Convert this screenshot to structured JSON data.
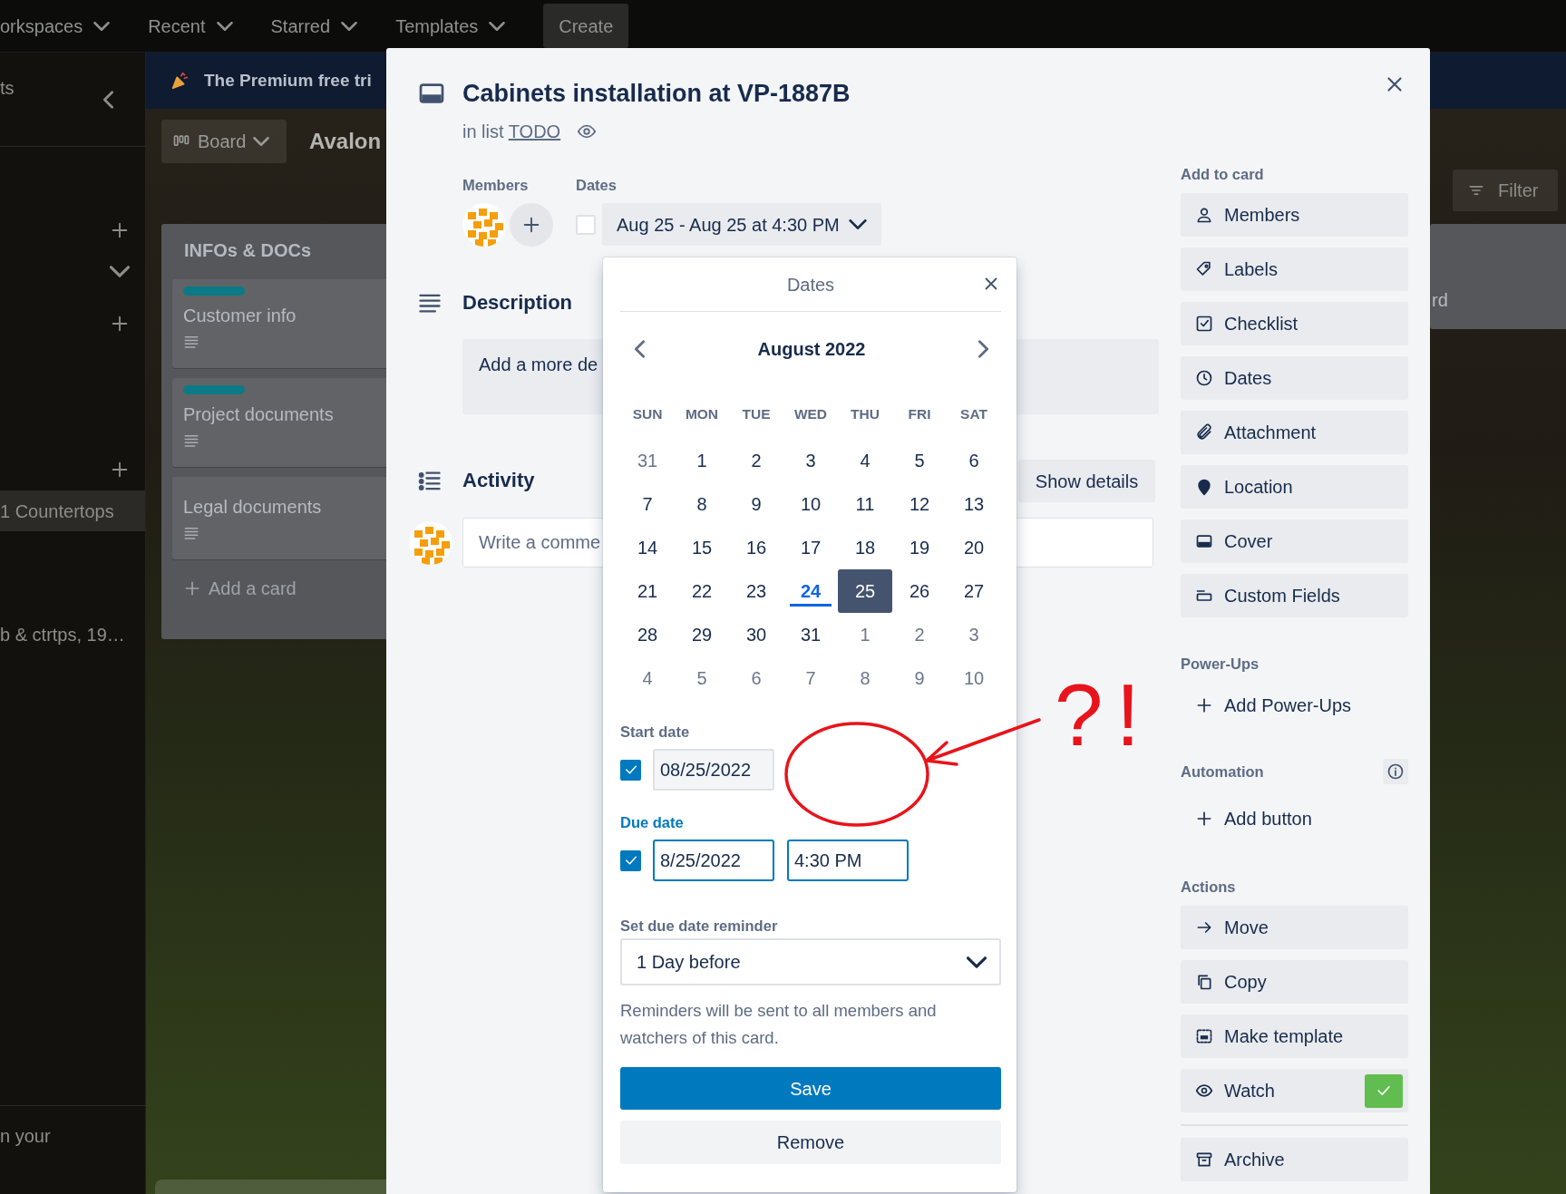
{
  "top_nav": {
    "items": [
      {
        "label": "orkspaces"
      },
      {
        "label": "Recent"
      },
      {
        "label": "Starred"
      },
      {
        "label": "Templates"
      }
    ],
    "create_button": "Create"
  },
  "sidebar": {
    "title": "ts",
    "items": [
      {
        "label": "1 Countertops",
        "selected": true
      },
      {
        "label": "b & ctrtps, 19…",
        "selected": false
      }
    ],
    "footer": "n your"
  },
  "banner": {
    "text": "The Premium free tri"
  },
  "board": {
    "view_button": "Board",
    "title": "Avalon",
    "filter_button": "Filter",
    "lists": [
      {
        "title": "INFOs & DOCs",
        "cards": [
          {
            "title": "Customer info",
            "labels": [
              {
                "color": "#0b7a86"
              }
            ],
            "has_description": true
          },
          {
            "title": "Project documents",
            "labels": [
              {
                "color": "#0b7a86"
              }
            ],
            "has_description": true
          },
          {
            "title": "Legal documents",
            "has_description": true
          }
        ],
        "add_card": "Add a card"
      }
    ],
    "partial_list": {
      "text": "rd"
    }
  },
  "card_modal": {
    "title": "Cabinets installation at VP-1887B",
    "list_prefix": "in list",
    "list_name": "TODO",
    "watching": true,
    "members_label": "Members",
    "dates_label": "Dates",
    "dates_complete": false,
    "dates_value": "Aug 25 - Aug 25 at 4:30 PM",
    "description_heading": "Description",
    "description_placeholder": "Add a more de",
    "activity_heading": "Activity",
    "show_details": "Show details",
    "comment_placeholder": "Write a comme",
    "sidebar": {
      "sections": [
        {
          "title": "Add to card",
          "info": false,
          "items": [
            {
              "label": "Members",
              "kind": "button"
            },
            {
              "label": "Labels",
              "kind": "button"
            },
            {
              "label": "Checklist",
              "kind": "button"
            },
            {
              "label": "Dates",
              "kind": "button"
            },
            {
              "label": "Attachment",
              "kind": "button"
            },
            {
              "label": "Location",
              "kind": "button"
            },
            {
              "label": "Cover",
              "kind": "button"
            },
            {
              "label": "Custom Fields",
              "kind": "button"
            }
          ]
        },
        {
          "title": "Power-Ups",
          "info": false,
          "items": [
            {
              "label": "Add Power-Ups",
              "kind": "link"
            }
          ]
        },
        {
          "title": "Automation",
          "info": true,
          "items": [
            {
              "label": "Add button",
              "kind": "link"
            }
          ]
        },
        {
          "title": "Actions",
          "info": false,
          "items": [
            {
              "label": "Move",
              "kind": "button"
            },
            {
              "label": "Copy",
              "kind": "button"
            },
            {
              "label": "Make template",
              "kind": "button"
            },
            {
              "label": "Watch",
              "kind": "toggle",
              "checked": true
            },
            {
              "label": "Archive",
              "kind": "button",
              "divider_before": true
            }
          ]
        }
      ]
    }
  },
  "dates_popover": {
    "title": "Dates",
    "month": "August 2022",
    "weekdays": [
      "SUN",
      "MON",
      "TUE",
      "WED",
      "THU",
      "FRI",
      "SAT"
    ],
    "weeks": [
      [
        {
          "day": "31",
          "outside": true,
          "today": false,
          "selected": false
        },
        {
          "day": "1",
          "outside": false,
          "today": false,
          "selected": false
        },
        {
          "day": "2",
          "outside": false,
          "today": false,
          "selected": false
        },
        {
          "day": "3",
          "outside": false,
          "today": false,
          "selected": false
        },
        {
          "day": "4",
          "outside": false,
          "today": false,
          "selected": false
        },
        {
          "day": "5",
          "outside": false,
          "today": false,
          "selected": false
        },
        {
          "day": "6",
          "outside": false,
          "today": false,
          "selected": false
        }
      ],
      [
        {
          "day": "7",
          "outside": false,
          "today": false,
          "selected": false
        },
        {
          "day": "8",
          "outside": false,
          "today": false,
          "selected": false
        },
        {
          "day": "9",
          "outside": false,
          "today": false,
          "selected": false
        },
        {
          "day": "10",
          "outside": false,
          "today": false,
          "selected": false
        },
        {
          "day": "11",
          "outside": false,
          "today": false,
          "selected": false
        },
        {
          "day": "12",
          "outside": false,
          "today": false,
          "selected": false
        },
        {
          "day": "13",
          "outside": false,
          "today": false,
          "selected": false
        }
      ],
      [
        {
          "day": "14",
          "outside": false,
          "today": false,
          "selected": false
        },
        {
          "day": "15",
          "outside": false,
          "today": false,
          "selected": false
        },
        {
          "day": "16",
          "outside": false,
          "today": false,
          "selected": false
        },
        {
          "day": "17",
          "outside": false,
          "today": false,
          "selected": false
        },
        {
          "day": "18",
          "outside": false,
          "today": false,
          "selected": false
        },
        {
          "day": "19",
          "outside": false,
          "today": false,
          "selected": false
        },
        {
          "day": "20",
          "outside": false,
          "today": false,
          "selected": false
        }
      ],
      [
        {
          "day": "21",
          "outside": false,
          "today": false,
          "selected": false
        },
        {
          "day": "22",
          "outside": false,
          "today": false,
          "selected": false
        },
        {
          "day": "23",
          "outside": false,
          "today": false,
          "selected": false
        },
        {
          "day": "24",
          "outside": false,
          "today": true,
          "selected": false
        },
        {
          "day": "25",
          "outside": false,
          "today": false,
          "selected": true
        },
        {
          "day": "26",
          "outside": false,
          "today": false,
          "selected": false
        },
        {
          "day": "27",
          "outside": false,
          "today": false,
          "selected": false
        }
      ],
      [
        {
          "day": "28",
          "outside": false,
          "today": false,
          "selected": false
        },
        {
          "day": "29",
          "outside": false,
          "today": false,
          "selected": false
        },
        {
          "day": "30",
          "outside": false,
          "today": false,
          "selected": false
        },
        {
          "day": "31",
          "outside": false,
          "today": false,
          "selected": false
        },
        {
          "day": "1",
          "outside": true,
          "today": false,
          "selected": false
        },
        {
          "day": "2",
          "outside": true,
          "today": false,
          "selected": false
        },
        {
          "day": "3",
          "outside": true,
          "today": false,
          "selected": false
        }
      ],
      [
        {
          "day": "4",
          "outside": true,
          "today": false,
          "selected": false
        },
        {
          "day": "5",
          "outside": true,
          "today": false,
          "selected": false
        },
        {
          "day": "6",
          "outside": true,
          "today": false,
          "selected": false
        },
        {
          "day": "7",
          "outside": true,
          "today": false,
          "selected": false
        },
        {
          "day": "8",
          "outside": true,
          "today": false,
          "selected": false
        },
        {
          "day": "9",
          "outside": true,
          "today": false,
          "selected": false
        },
        {
          "day": "10",
          "outside": true,
          "today": false,
          "selected": false
        }
      ]
    ],
    "start_date": {
      "label": "Start date",
      "enabled": true,
      "active": false,
      "date": "08/25/2022"
    },
    "due_date": {
      "label": "Due date",
      "enabled": true,
      "active": true,
      "date": "8/25/2022",
      "time": "4:30 PM"
    },
    "reminder": {
      "label": "Set due date reminder",
      "value": "1 Day before",
      "help": "Reminders will be sent to all members and watchers of this card."
    },
    "save_button": "Save",
    "remove_button": "Remove"
  },
  "annotation": {
    "text": "?!"
  }
}
